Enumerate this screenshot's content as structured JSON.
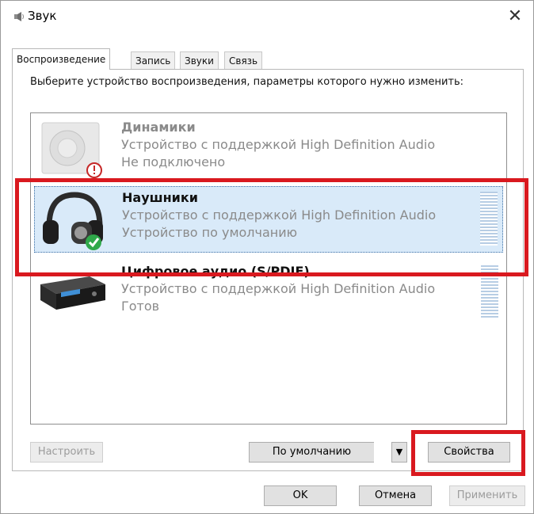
{
  "window": {
    "title": "Звук",
    "icon": "speaker-icon",
    "close_glyph": "✕"
  },
  "tabs": [
    {
      "label": "Воспроизведение",
      "active": true
    },
    {
      "label": "Запись",
      "active": false
    },
    {
      "label": "Звуки",
      "active": false
    },
    {
      "label": "Связь",
      "active": false
    }
  ],
  "instruction": "Выберите устройство воспроизведения, параметры которого нужно изменить:",
  "devices": [
    {
      "name": "Динамики",
      "description": "Устройство с поддержкой High Definition Audio",
      "status": "Не подключено",
      "icon": "speakers-icon",
      "badge": "disconnected-icon",
      "selected": false,
      "disabled": true
    },
    {
      "name": "Наушники",
      "description": "Устройство с поддержкой High Definition Audio",
      "status": "Устройство по умолчанию",
      "icon": "headphones-icon",
      "badge": "default-check-icon",
      "selected": true,
      "disabled": false
    },
    {
      "name": "Цифровое аудио (S/PDIF)",
      "description": "Устройство с поддержкой High Definition Audio",
      "status": "Готов",
      "icon": "digital-audio-icon",
      "badge": "",
      "selected": false,
      "disabled": false
    }
  ],
  "buttons": {
    "configure": "Настроить",
    "set_default": "По умолчанию",
    "set_default_arrow": "▼",
    "properties": "Свойства",
    "ok": "OK",
    "cancel": "Отмена",
    "apply": "Применить"
  },
  "colors": {
    "highlight": "#d9191f",
    "selected_bg": "#d9eaf9",
    "check_green": "#2fa84a"
  }
}
